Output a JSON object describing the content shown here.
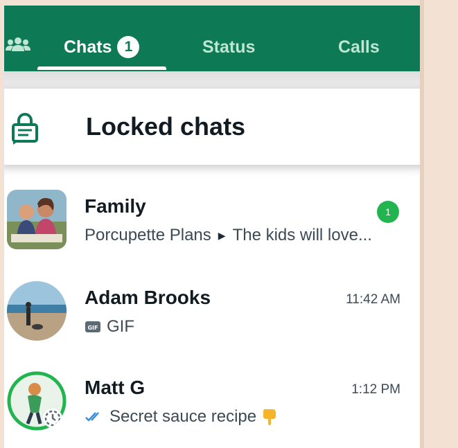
{
  "tabs": {
    "chats_label": "Chats",
    "chats_badge": "1",
    "status_label": "Status",
    "calls_label": "Calls",
    "active": "chats"
  },
  "locked_chats": {
    "label": "Locked chats"
  },
  "chats": [
    {
      "name": "Family",
      "sender": "Porcupette Plans",
      "message": "The kids will love...",
      "unread": "1",
      "time": ""
    },
    {
      "name": "Adam Brooks",
      "attachment": "GIF",
      "time": "11:42 AM"
    },
    {
      "name": "Matt G",
      "message": "Secret sauce recipe",
      "time": "1:12 PM"
    }
  ],
  "colors": {
    "header": "#0d7a55",
    "accent_green": "#22b44f",
    "read_ticks": "#3b8fd9",
    "background": "#f3e2d4"
  },
  "icons": [
    "community-icon",
    "lock-chat-icon",
    "gif-icon",
    "double-check-icon",
    "pointing-down-emoji-icon",
    "status-ring-icon"
  ]
}
